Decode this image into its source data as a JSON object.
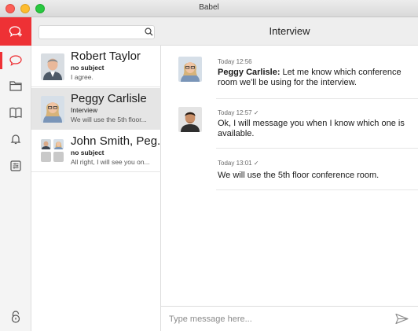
{
  "window": {
    "title": "Babel"
  },
  "search": {
    "placeholder": ""
  },
  "conversations": [
    {
      "name": "Robert Taylor",
      "subject": "no subject",
      "preview": "I agree."
    },
    {
      "name": "Peggy Carlisle",
      "subject": "Interview",
      "preview": "We will use the 5th floor..."
    },
    {
      "name": "John Smith, Peg...",
      "subject": "no subject",
      "preview": "All right, I will see you on..."
    }
  ],
  "chat": {
    "title": "Interview",
    "messages": [
      {
        "time": "Today 12:56",
        "sender": "Peggy Carlisle:",
        "text": "Let me know which conference room we'll be using for the interview."
      },
      {
        "time": "Today 12:57",
        "check": "✓",
        "text": "Ok, I will message you when I know which one is available."
      },
      {
        "time": "Today 13:01",
        "check": "✓",
        "text": "We will use the 5th floor conference room."
      }
    ],
    "composer_placeholder": "Type message here..."
  },
  "colors": {
    "accent": "#ee3135",
    "selected": "#e5e5e5"
  },
  "icons": [
    "new-chat-icon",
    "chat-icon",
    "folder-icon",
    "book-icon",
    "bell-icon",
    "settings-icon",
    "lock-icon",
    "search-icon",
    "send-icon"
  ]
}
